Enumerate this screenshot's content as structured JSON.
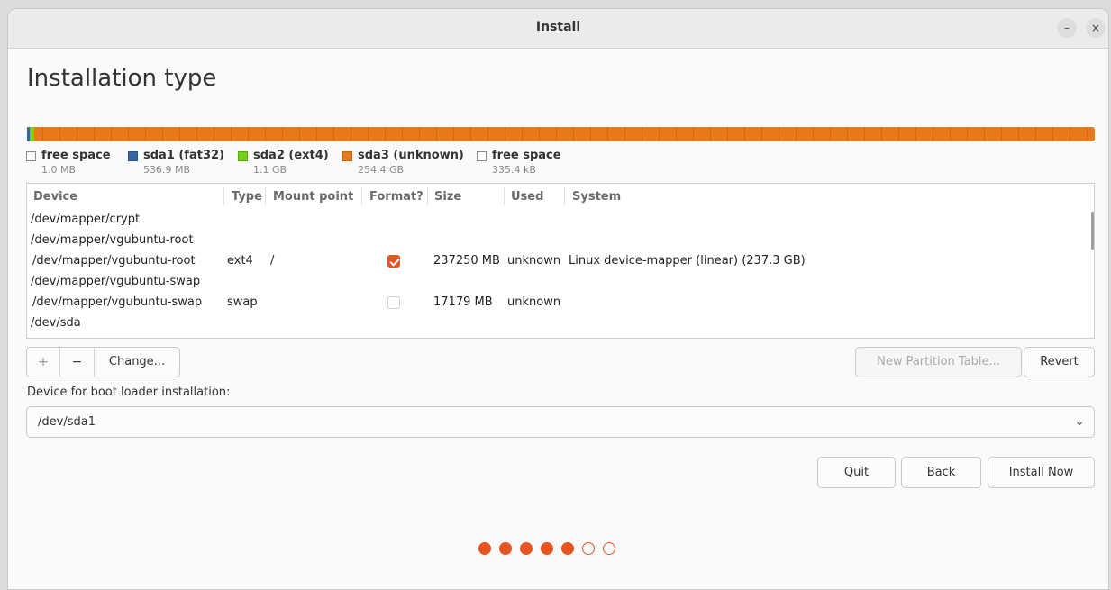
{
  "window": {
    "title": "Install",
    "minimize_icon": "minimize-icon",
    "close_icon": "close-icon"
  },
  "page": {
    "title": "Installation type"
  },
  "partition_bar": {
    "colors": {
      "free": "#ffffff",
      "sda1": "#3465a4",
      "sda2": "#73d216",
      "sda3": "#e47a1c"
    }
  },
  "legend": [
    {
      "name": "free space",
      "size": "1.0 MB",
      "color": "#ffffff"
    },
    {
      "name": "sda1 (fat32)",
      "size": "536.9 MB",
      "color": "#3465a4"
    },
    {
      "name": "sda2 (ext4)",
      "size": "1.1 GB",
      "color": "#73d216"
    },
    {
      "name": "sda3 (unknown)",
      "size": "254.4 GB",
      "color": "#e47a1c"
    },
    {
      "name": "free space",
      "size": "335.4 kB",
      "color": "#ffffff"
    }
  ],
  "table": {
    "headers": [
      "Device",
      "Type",
      "Mount point",
      "Format?",
      "Size",
      "Used",
      "System"
    ],
    "rows": [
      {
        "device": "/dev/mapper/crypt",
        "type": "",
        "mount": "",
        "format": null,
        "size": "",
        "used": "",
        "system": ""
      },
      {
        "device": "/dev/mapper/vgubuntu-root",
        "type": "",
        "mount": "",
        "format": null,
        "size": "",
        "used": "",
        "system": ""
      },
      {
        "device": " /dev/mapper/vgubuntu-root",
        "type": "ext4",
        "mount": "/",
        "format": true,
        "size": "237250 MB",
        "used": "unknown",
        "system": "Linux device-mapper (linear) (237.3 GB)"
      },
      {
        "device": "/dev/mapper/vgubuntu-swap",
        "type": "",
        "mount": "",
        "format": null,
        "size": "",
        "used": "",
        "system": ""
      },
      {
        "device": " /dev/mapper/vgubuntu-swap",
        "type": "swap",
        "mount": "",
        "format": false,
        "size": "17179 MB",
        "used": "unknown",
        "system": ""
      },
      {
        "device": "/dev/sda",
        "type": "",
        "mount": "",
        "format": null,
        "size": "",
        "used": "",
        "system": ""
      }
    ]
  },
  "toolbar": {
    "add_label": "+",
    "remove_label": "−",
    "change_label": "Change...",
    "new_partition_table_label": "New Partition Table...",
    "revert_label": "Revert"
  },
  "bootloader": {
    "label": "Device for boot loader installation:",
    "value": "/dev/sda1",
    "chevron": "⌄"
  },
  "actions": {
    "quit_label": "Quit",
    "back_label": "Back",
    "install_now_label": "Install Now"
  },
  "progress": {
    "total_steps": 7,
    "completed_steps": 5,
    "accent": "#e95420"
  }
}
